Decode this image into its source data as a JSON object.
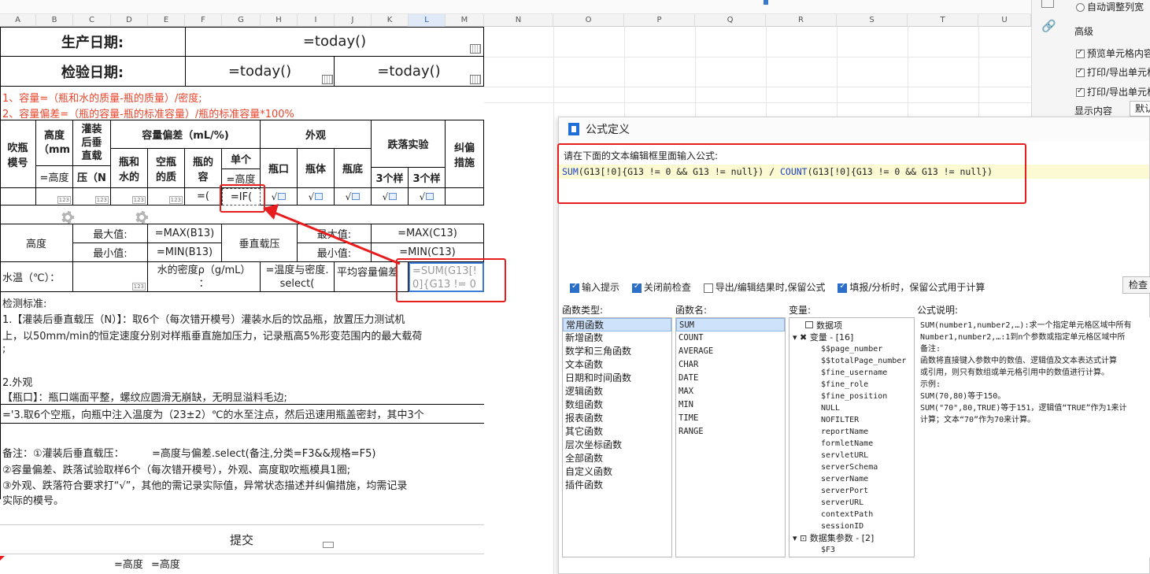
{
  "columns": [
    "A",
    "B",
    "C",
    "D",
    "E",
    "F",
    "G",
    "H",
    "I",
    "J",
    "K",
    "L",
    "M",
    "N",
    "O",
    "P",
    "Q",
    "R",
    "S",
    "T",
    "U"
  ],
  "sheet": {
    "production_date_label": "生产日期:",
    "production_date_formula": "=today()",
    "inspection_date_label": "检验日期:",
    "inspection_date_formula_1": "=today()",
    "inspection_date_formula_2": "=today()",
    "note_line_1": "1、容量=（瓶和水的质量-瓶的质量）/密度;",
    "note_line_2": "2、容量偏差=（瓶的容量-瓶的标准容量）/瓶的标准容量*100%",
    "headers": {
      "mold_no": "吹瓶模号",
      "height": "高度（mm",
      "height_formula": "=高度",
      "filled_load": "灌装后垂直载",
      "filled_load_tail": "压（N",
      "capacity_dev": "容量偏差（mL/%)",
      "bottle_water": "瓶和水的",
      "empty_bottle": "空瓶的质",
      "bottle_cap": "瓶的容",
      "single": "单个",
      "single_formula": "=高度",
      "appearance": "外观",
      "mouth": "瓶口",
      "body": "瓶体",
      "bottom": "瓶底",
      "drop_test": "跌落实验",
      "drop_3a": "3个样",
      "drop_3b": "3个样",
      "correct": "纠偏措施"
    },
    "data_row": {
      "cap_formula": "=(",
      "if_formula": "=IF(",
      "check": "√"
    },
    "summary": {
      "height_label": "高度",
      "max_label": "最大值:",
      "min_label": "最小值:",
      "max_b13": "=MAX(B13)",
      "min_b13": "=MIN(B13)",
      "vertical_load": "垂直载压",
      "max_label_2": "最大值:",
      "min_label_2": "最小值:",
      "max_c13": "=MAX(C13)",
      "min_c13": "=MIN(C13)",
      "water_temp": "水温（℃）：",
      "density": "水的密度ρ（g/mL）",
      "density_tail": "：",
      "temp_density": "=温度与密度.",
      "temp_density_tail": "select(",
      "avg_dev": "平均容量偏差",
      "avg_formula_1": "=SUM(G13[!",
      "avg_formula_2": "0]{G13 != 0"
    },
    "standards": {
      "title": "检测标准:",
      "item1_a": "1.【灌装后垂直载压（N）】：取6个（每次错开模号）灌装水后的饮品瓶，放置压力测试机",
      "item1_b": "上，以50mm/min的恒定速度分别对样瓶垂直施加压力，记录瓶高5%形变范围内的最大载荷",
      "item1_c": ";",
      "item2": "2.外观",
      "item2_detail": "【瓶口】：瓶口端面平整，螺纹应圆滑无崩缺，无明显溢料毛边;",
      "item3": "='3.取6个空瓶，向瓶中注入温度为（23±2）℃的水至注点，然后迅速用瓶盖密封，其中3个"
    },
    "remarks": {
      "label": "备注：①灌装后垂直载压：",
      "formula": "=高度与偏差.select(备注,分类=F3&&规格=F5)",
      "line2": "②容量偏差、跌落试验取样6个（每次错开模号），外观、高度取吹瓶模具1圈;",
      "line3": "③外观、跌落符合要求打“√”，其他的需记录实际值，异常状态描述并纠偏措施，均需记录",
      "line4": "实际的模号。"
    },
    "submit": "提交",
    "bottom_formula_1": "=高度",
    "bottom_formula_2": "=高度"
  },
  "right_panel": {
    "auto_width": "自动调整列宽",
    "advanced": "高级",
    "opt1": "预览单元格内容",
    "opt2": "打印/导出单元格",
    "opt3": "打印/导出单元格",
    "display_content": "显示内容",
    "default": "默认"
  },
  "dialog": {
    "title": "公式定义",
    "editor_label": "请在下面的文本编辑框里面输入公式:",
    "formula_parts": {
      "sum_fn": "SUM",
      "sum_body": "(G13[!0]{G13 != 0 && G13 != null}) / ",
      "count_fn": "COUNT",
      "count_body": "(G13[!0]{G13 != 0 && G13 != null})"
    },
    "options": {
      "input_hint": "输入提示",
      "check_before_close": "关闭前检查",
      "keep_formula_export": "导出/编辑结果时,保留公式",
      "keep_formula_fill": "填报/分析时，保留公式用于计算"
    },
    "check_button": "检查",
    "labels": {
      "fn_type": "函数类型:",
      "fn_name": "函数名:",
      "variables": "变量:",
      "description": "公式说明:"
    },
    "function_types": [
      "常用函数",
      "新增函数",
      "数学和三角函数",
      "文本函数",
      "日期和时间函数",
      "逻辑函数",
      "数组函数",
      "报表函数",
      "其它函数",
      "层次坐标函数",
      "全部函数",
      "自定义函数",
      "插件函数"
    ],
    "function_names": [
      "SUM",
      "COUNT",
      "AVERAGE",
      "CHAR",
      "DATE",
      "MAX",
      "MIN",
      "TIME",
      "RANGE"
    ],
    "variables": {
      "data_item": "数据项",
      "var_group": "变量 - [16]",
      "items": [
        "$$page_number",
        "$$totalPage_number",
        "$fine_username",
        "$fine_role",
        "$fine_position",
        "NULL",
        "NOFILTER",
        "reportName",
        "formletName",
        "servletURL",
        "serverSchema",
        "serverName",
        "serverPort",
        "serverURL",
        "contextPath",
        "sessionID"
      ],
      "dataset_group": "数据集参数 - [2]",
      "dataset_item": "$F3"
    },
    "description": {
      "line1": "SUM(number1,number2,…):求一个指定单元格区域中所有",
      "line2": "Number1,number2,…:1到n个参数或指定单元格区域中所",
      "line3": "备注:",
      "line4": "函数将直接键入参数中的数值、逻辑值及文本表达式计算",
      "line5": "或引用，则只有数组或单元格引用中的数值进行计算。",
      "line6": "示例:",
      "line7": "SUM(70,80)等于150。",
      "line8": "SUM(\"70\",80,TRUE)等于151，逻辑值“TRUE”作为1来计",
      "line9": "计算；文本“70”作为70来计算。"
    }
  },
  "colors": {
    "accent": "#2c6fc9",
    "highlight_box": "#e81e1e",
    "note_red": "#e8452c",
    "editor_bg": "#fbfad2"
  }
}
